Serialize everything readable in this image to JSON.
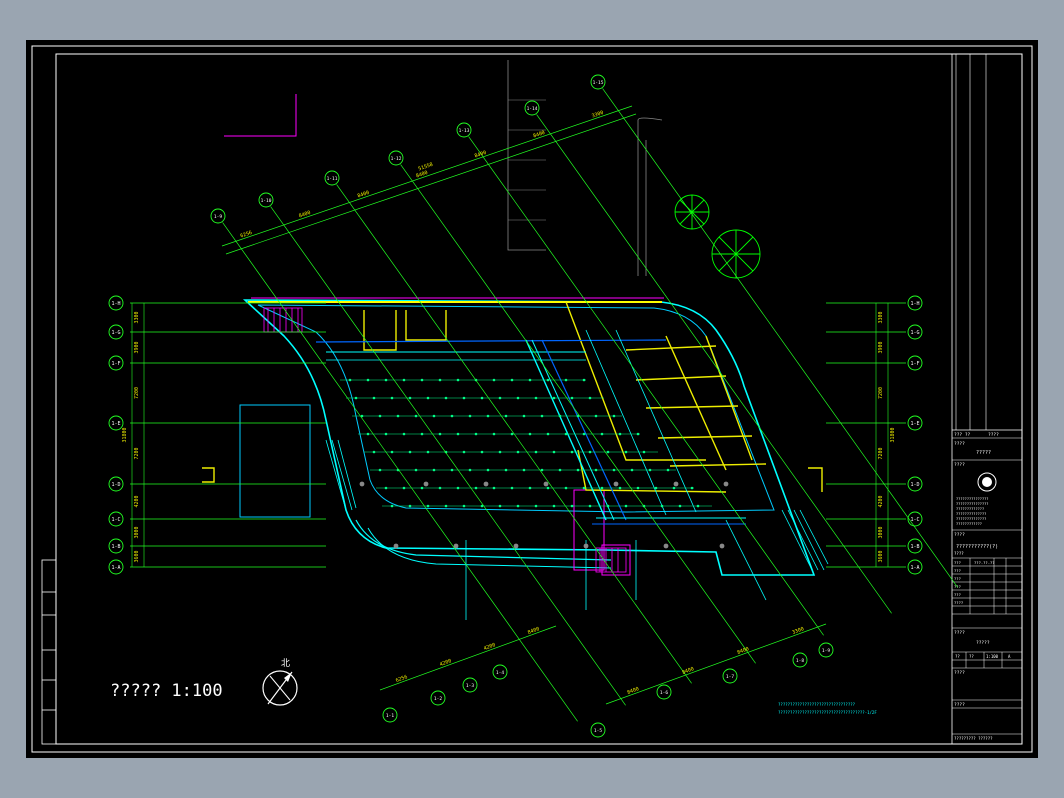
{
  "drawing": {
    "scale_label": "?????  1:100",
    "north_label": "北"
  },
  "grid": {
    "row_axes_left": [
      "1-H",
      "1-G",
      "1-F",
      "1-E",
      "1-D",
      "1-C",
      "1-B",
      "1-A"
    ],
    "row_axes_right": [
      "1-H",
      "1-G",
      "1-F",
      "1-E",
      "1-D",
      "1-C",
      "1-B",
      "1-A"
    ],
    "row_dims": [
      "3300",
      "3900",
      "7200",
      "7200",
      "4200",
      "3000",
      "3600"
    ],
    "row_total": "31800",
    "col_axes_top": [
      "1-9",
      "1-10",
      "1-11",
      "1-12",
      "1-13",
      "1-14",
      "1-15"
    ],
    "col_axes_bottom": [
      "1-1",
      "1-2",
      "1-3",
      "1-4",
      "1-5",
      "1-6",
      "1-7",
      "1-8",
      "1-9"
    ],
    "top_dims": [
      "6256",
      "8400",
      "8400",
      "8400",
      "8400",
      "8400",
      "3300"
    ],
    "top_total": "51558",
    "bottom_dims_left": [
      "6256",
      "4200",
      "4200",
      "8400"
    ],
    "bottom_dims_right": [
      "8400",
      "8400",
      "8400",
      "3300"
    ]
  },
  "notes": {
    "bottom_note_1": "????????????????????????????????",
    "bottom_note_2": "????????????????????????????????????-1/2F"
  },
  "title_block": {
    "header_left": "??? ??",
    "header_right": "????",
    "label_project": "????",
    "project_name": "?????",
    "label_client": "????",
    "company_lines": [
      "???????????????",
      "???????????????",
      "?????????????",
      "??????????????",
      "??????????????",
      "????????????"
    ],
    "label_drawing": "????",
    "drawing_title": "???????????(?)",
    "label_number": "????",
    "rows": [
      {
        "k": "???",
        "v": "???-??-??"
      },
      {
        "k": "???",
        "v": ""
      },
      {
        "k": "???",
        "v": ""
      },
      {
        "k": "???",
        "v": ""
      },
      {
        "k": "???",
        "v": ""
      },
      {
        "k": "????",
        "v": ""
      }
    ],
    "label_stage": "????",
    "stage_value": "?????",
    "scale_row": {
      "a": "??",
      "b": "??",
      "c": "1:100",
      "d": "A"
    },
    "label_remark": "????",
    "label_date": "????",
    "footer": "????????? ??????"
  }
}
